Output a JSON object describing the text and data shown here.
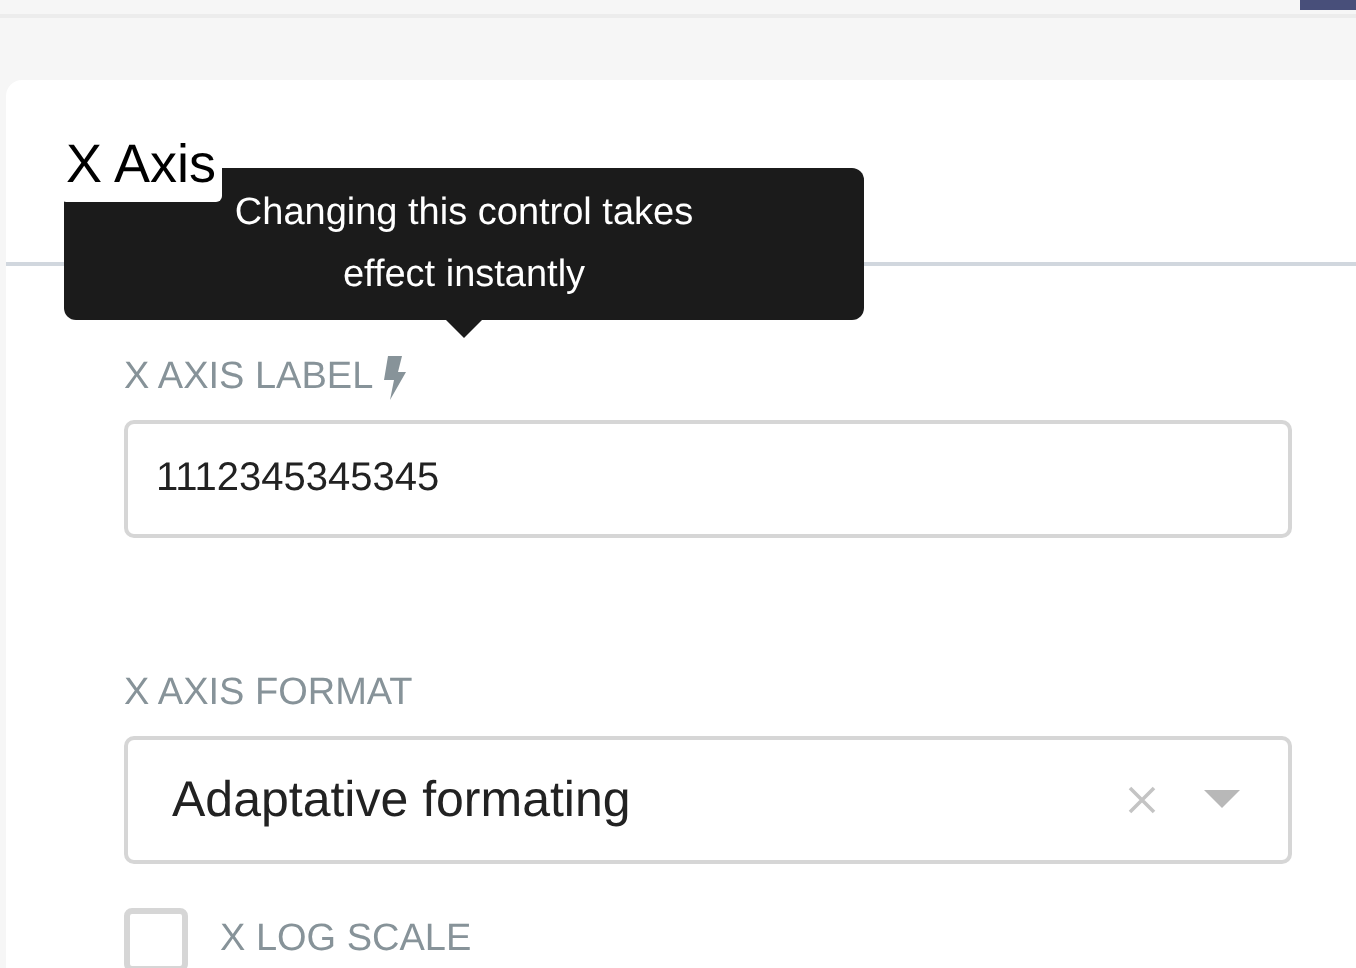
{
  "section": {
    "title": "X Axis"
  },
  "tooltip": {
    "text": "Changing this control takes effect instantly"
  },
  "fields": [
    {
      "kind": "text",
      "label": "X AXIS LABEL",
      "instant": true,
      "value": "1112345345345"
    },
    {
      "kind": "select",
      "label": "X AXIS FORMAT",
      "value": "Adaptative formating",
      "clearable": true
    },
    {
      "kind": "checkbox",
      "label": "X LOG SCALE",
      "checked": false
    }
  ]
}
